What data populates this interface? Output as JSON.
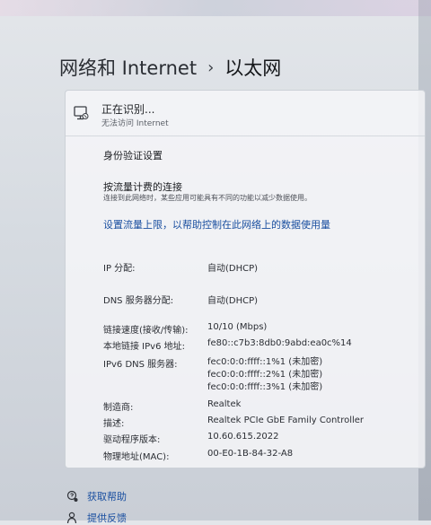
{
  "breadcrumb": {
    "parent": "网络和 Internet",
    "separator": "›",
    "current": "以太网"
  },
  "status": {
    "title": "正在识别...",
    "subtitle": "无法访问 Internet",
    "icon": "ethernet-network-icon"
  },
  "links": {
    "auth_settings": "身份验证设置",
    "metered_title": "按流量计费的连接",
    "metered_desc": "连接到此网络时，某些应用可能具有不同的功能以减少数据使用。",
    "data_limit": "设置流量上限，以帮助控制在此网络上的数据使用量"
  },
  "properties": {
    "ip_assignment": {
      "label": "IP 分配:",
      "value": "自动(DHCP)"
    },
    "dns_assignment": {
      "label": "DNS 服务器分配:",
      "value": "自动(DHCP)"
    },
    "link_speed": {
      "label": "链接速度(接收/传输):",
      "value": "10/10 (Mbps)"
    },
    "ipv6_local": {
      "label": "本地链接 IPv6 地址:",
      "value": "fe80::c7b3:8db0:9abd:ea0c%14"
    },
    "ipv6_dns": {
      "label": "IPv6 DNS 服务器:",
      "values": [
        "fec0:0:0:ffff::1%1 (未加密)",
        "fec0:0:0:ffff::2%1 (未加密)",
        "fec0:0:0:ffff::3%1 (未加密)"
      ]
    },
    "manufacturer": {
      "label": "制造商:",
      "value": "Realtek"
    },
    "description": {
      "label": "描述:",
      "value": "Realtek PCIe GbE Family Controller"
    },
    "driver_version": {
      "label": "驱动程序版本:",
      "value": "10.60.615.2022"
    },
    "mac": {
      "label": "物理地址(MAC):",
      "value": "00-E0-1B-84-32-A8"
    }
  },
  "bottom": {
    "help": "获取帮助",
    "feedback": "提供反馈"
  },
  "colors": {
    "link_blue": "#1a4fa0"
  }
}
